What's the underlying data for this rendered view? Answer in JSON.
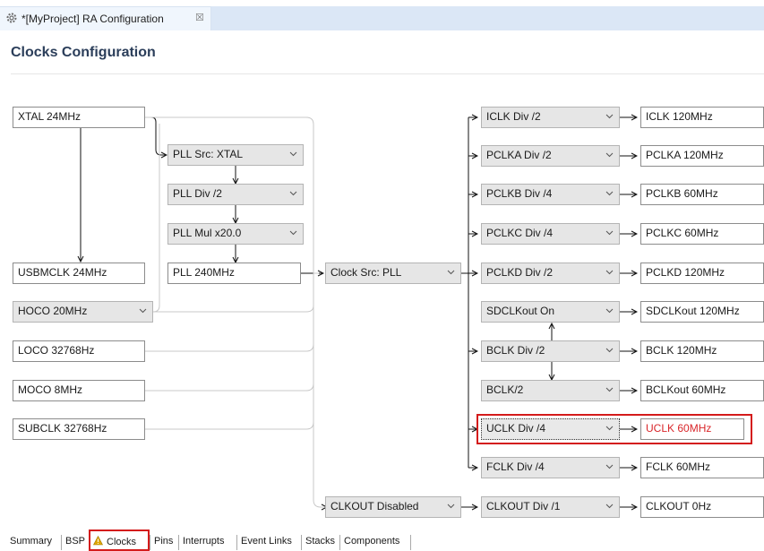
{
  "editor_tab": {
    "title": "*[MyProject] RA Configuration",
    "close_glyph": "☒",
    "icon": "gear-icon"
  },
  "page_title": "Clocks Configuration",
  "sources": {
    "xtal": "XTAL 24MHz",
    "usbmclk": "USBMCLK 24MHz",
    "hoco": "HOCO 20MHz",
    "loco": "LOCO 32768Hz",
    "moco": "MOCO 8MHz",
    "subclk": "SUBCLK 32768Hz"
  },
  "pll": {
    "src": "PLL Src: XTAL",
    "div": "PLL Div /2",
    "mul": "PLL Mul x20.0",
    "out": "PLL 240MHz"
  },
  "clock_src": "Clock Src: PLL",
  "clkout": {
    "source": "CLKOUT Disabled",
    "div": "CLKOUT Div /1",
    "out": "CLKOUT 0Hz"
  },
  "dividers": [
    {
      "div": "ICLK Div /2",
      "out": "ICLK 120MHz"
    },
    {
      "div": "PCLKA Div /2",
      "out": "PCLKA 120MHz"
    },
    {
      "div": "PCLKB Div /4",
      "out": "PCLKB 60MHz"
    },
    {
      "div": "PCLKC Div /4",
      "out": "PCLKC 60MHz"
    },
    {
      "div": "PCLKD Div /2",
      "out": "PCLKD 120MHz"
    },
    {
      "div": "SDCLKout On",
      "out": "SDCLKout 120MHz"
    },
    {
      "div": "BCLK Div /2",
      "out": "BCLK 120MHz"
    },
    {
      "div": "BCLK/2",
      "out": "BCLKout 60MHz"
    },
    {
      "div": "UCLK Div /4",
      "out": "UCLK 60MHz"
    },
    {
      "div": "FCLK Div /4",
      "out": "FCLK 60MHz"
    }
  ],
  "bottom_tabs": [
    "Summary",
    "BSP",
    "Clocks",
    "Pins",
    "Interrupts",
    "Event Links",
    "Stacks",
    "Components"
  ],
  "colors": {
    "highlight": "#d41b1b",
    "uclk_text": "#d9262a",
    "heading": "#2b3e5a",
    "warning": "#e0a800"
  }
}
